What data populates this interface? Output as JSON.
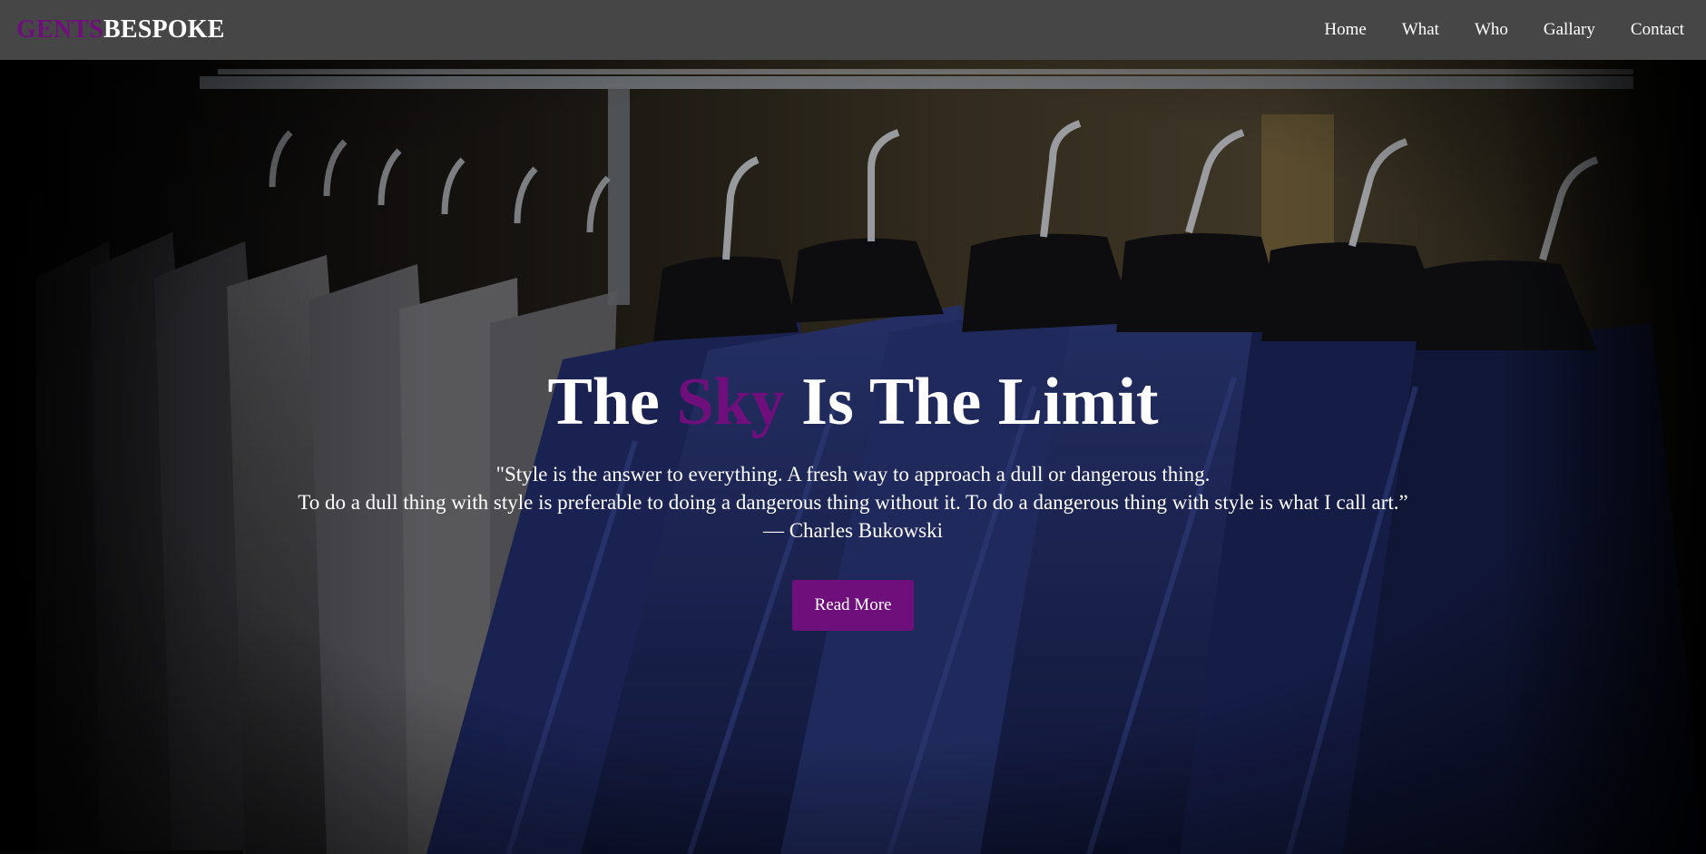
{
  "brand": {
    "part_a": "GENTS",
    "part_b": "BESPOKE"
  },
  "nav": {
    "items": [
      {
        "label": "Home"
      },
      {
        "label": "What"
      },
      {
        "label": "Who"
      },
      {
        "label": "Gallary"
      },
      {
        "label": "Contact"
      }
    ]
  },
  "hero": {
    "headline_before": "The ",
    "headline_accent": "Sky",
    "headline_after": " Is The Limit",
    "quote_line1": "\"Style is the answer to everything. A fresh way to approach a dull or dangerous thing.",
    "quote_line2": "To do a dull thing with style is preferable to doing a dangerous thing without it. To do a dangerous thing with style is what I call art.”",
    "quote_author": "— Charles Bukowski",
    "cta_label": "Read More"
  },
  "colors": {
    "accent": "#6e0f7c",
    "navbar": "#464646",
    "text": "#ffffff"
  }
}
